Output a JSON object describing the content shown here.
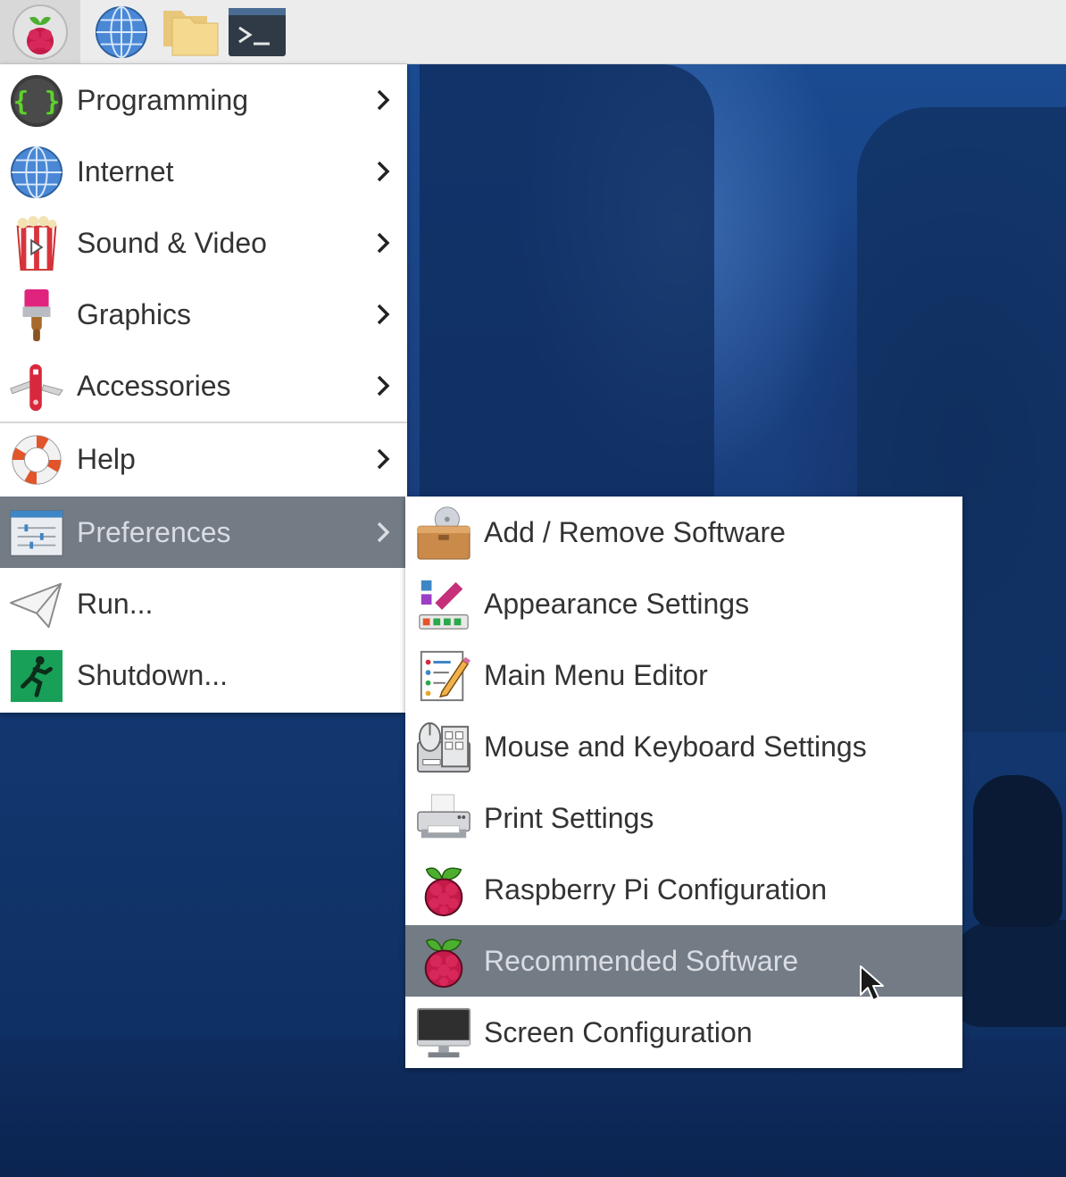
{
  "taskbar": {
    "buttons": [
      {
        "icon": "raspberry-icon"
      },
      {
        "icon": "web-browser-icon"
      },
      {
        "icon": "file-manager-icon"
      },
      {
        "icon": "terminal-icon"
      }
    ]
  },
  "main_menu": {
    "items": [
      {
        "label": "Programming",
        "icon": "braces-icon",
        "has_submenu": true
      },
      {
        "label": "Internet",
        "icon": "globe-icon",
        "has_submenu": true
      },
      {
        "label": "Sound & Video",
        "icon": "popcorn-icon",
        "has_submenu": true
      },
      {
        "label": "Graphics",
        "icon": "paintbrush-icon",
        "has_submenu": true
      },
      {
        "label": "Accessories",
        "icon": "pocket-knife-icon",
        "has_submenu": true
      },
      {
        "label": "Help",
        "icon": "lifebuoy-icon",
        "has_submenu": true
      },
      {
        "label": "Preferences",
        "icon": "settings-sliders-icon",
        "has_submenu": true,
        "selected": true
      },
      {
        "label": "Run...",
        "icon": "paper-plane-icon",
        "has_submenu": false
      },
      {
        "label": "Shutdown...",
        "icon": "exit-icon",
        "has_submenu": false
      }
    ]
  },
  "preferences_submenu": {
    "items": [
      {
        "label": "Add / Remove Software",
        "icon": "package-icon"
      },
      {
        "label": "Appearance Settings",
        "icon": "palette-icon"
      },
      {
        "label": "Main Menu Editor",
        "icon": "menu-editor-icon"
      },
      {
        "label": "Mouse and Keyboard Settings",
        "icon": "mouse-keyboard-icon"
      },
      {
        "label": "Print Settings",
        "icon": "printer-icon"
      },
      {
        "label": "Raspberry Pi Configuration",
        "icon": "raspberry-icon"
      },
      {
        "label": "Recommended Software",
        "icon": "raspberry-icon",
        "selected": true
      },
      {
        "label": "Screen Configuration",
        "icon": "monitor-icon"
      }
    ]
  },
  "colors": {
    "selection_bg": "#737b85",
    "selection_text": "#d9dde2",
    "menu_bg": "#ffffff",
    "text": "#333333"
  }
}
